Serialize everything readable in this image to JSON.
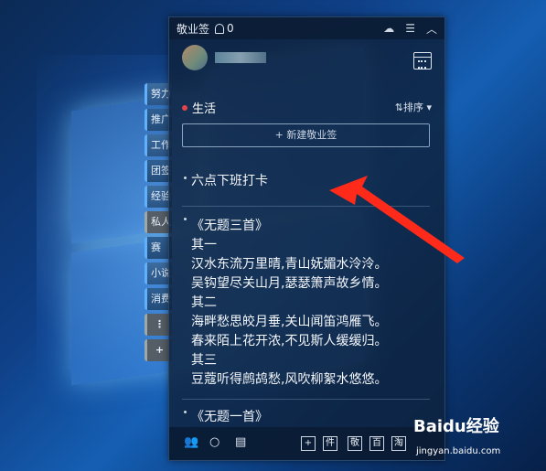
{
  "app": {
    "title": "敬业签",
    "bell_count": "0"
  },
  "titlebar_icons": [
    "cloud-sync-icon",
    "menu-icon",
    "collapse-icon"
  ],
  "side_tabs": [
    "努力",
    "推广",
    "工作",
    "团签",
    "经验",
    "私人",
    "赛",
    "小说",
    "消费",
    "⋮",
    "+"
  ],
  "category": {
    "name": "生活",
    "dot_color": "#e8424a",
    "sort_label": "⇅排序"
  },
  "new_note_label": "+ 新建敬业签",
  "notes": [
    {
      "title": "六点下班打卡"
    },
    {
      "title": "《无题三首》",
      "lines": [
        "其一",
        "汉水东流万里晴,青山妩媚水泠泠。",
        "吴钩望尽关山月,瑟瑟箫声故乡情。",
        "其二",
        "海畔愁思皎月垂,关山闻笛鸿雁飞。",
        "春来陌上花开浓,不见斯人缓缓归。",
        "其三",
        "豆蔻听得鹧鸪愁,风吹柳絮水悠悠。"
      ]
    },
    {
      "title": "《无题一首》"
    }
  ],
  "bottom_icons": [
    "contacts-icon",
    "search-icon",
    "calendar-list-icon"
  ],
  "bottom_buttons": [
    "+",
    "件",
    "敬",
    "百",
    "淘"
  ],
  "watermark": {
    "logo": "Baidu经验",
    "url": "jingyan.baidu.com"
  }
}
